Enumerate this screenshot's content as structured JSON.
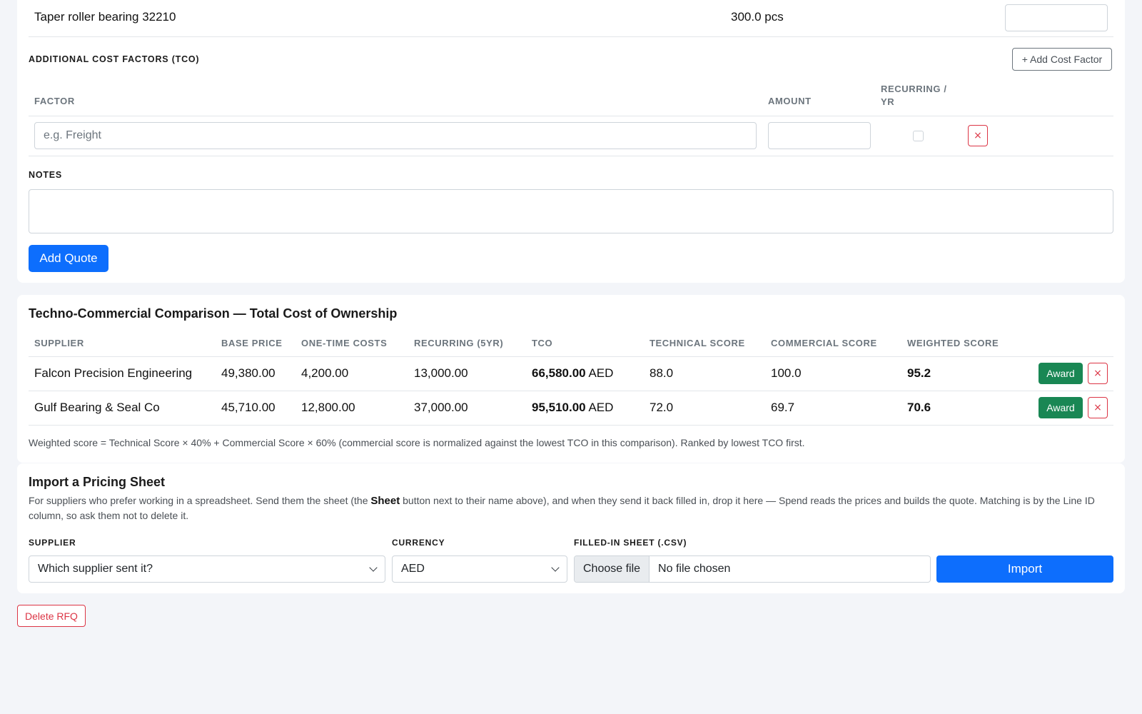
{
  "line_item": {
    "name": "Taper roller bearing 32210",
    "quantity": "300.0 pcs"
  },
  "additional_costs": {
    "title": "Additional Cost Factors (TCO)",
    "add_button": "+ Add Cost Factor",
    "headers": {
      "factor": "Factor",
      "amount": "Amount",
      "recurring_l1": "Recurring /",
      "recurring_l2": "Yr"
    },
    "factor_placeholder": "e.g. Freight",
    "remove_icon": "×"
  },
  "notes": {
    "label": "Notes"
  },
  "add_quote_button": "Add Quote",
  "comparison": {
    "title": "Techno-Commercial Comparison — Total Cost of Ownership",
    "headers": [
      "Supplier",
      "Base Price",
      "One-Time Costs",
      "Recurring (5yr)",
      "TCO",
      "Technical Score",
      "Commercial Score",
      "Weighted Score"
    ],
    "rows": [
      {
        "supplier": "Falcon Precision Engineering",
        "base_price": "49,380.00",
        "one_time": "4,200.00",
        "recurring": "13,000.00",
        "tco": "66,580.00",
        "currency": "AED",
        "technical": "88.0",
        "commercial": "100.0",
        "weighted": "95.2"
      },
      {
        "supplier": "Gulf Bearing & Seal Co",
        "base_price": "45,710.00",
        "one_time": "12,800.00",
        "recurring": "37,000.00",
        "tco": "95,510.00",
        "currency": "AED",
        "technical": "72.0",
        "commercial": "69.7",
        "weighted": "70.6"
      }
    ],
    "award_label": "Award",
    "remove_icon": "×",
    "note": "Weighted score = Technical Score × 40% + Commercial Score × 60% (commercial score is normalized against the lowest TCO in this comparison). Ranked by lowest TCO first."
  },
  "import": {
    "title": "Import a Pricing Sheet",
    "desc_before": "For suppliers who prefer working in a spreadsheet. Send them the sheet (the ",
    "desc_bold": "Sheet",
    "desc_after": " button next to their name above), and when they send it back filled in, drop it here — Spend reads the prices and builds the quote. Matching is by the Line ID column, so ask them not to delete it.",
    "supplier_label": "Supplier",
    "supplier_value": "Which supplier sent it?",
    "currency_label": "Currency",
    "currency_value": "AED",
    "file_label": "Filled-in Sheet (.csv)",
    "file_button": "Choose file",
    "file_status": "No file chosen",
    "import_button": "Import"
  },
  "delete_button": "Delete RFQ"
}
